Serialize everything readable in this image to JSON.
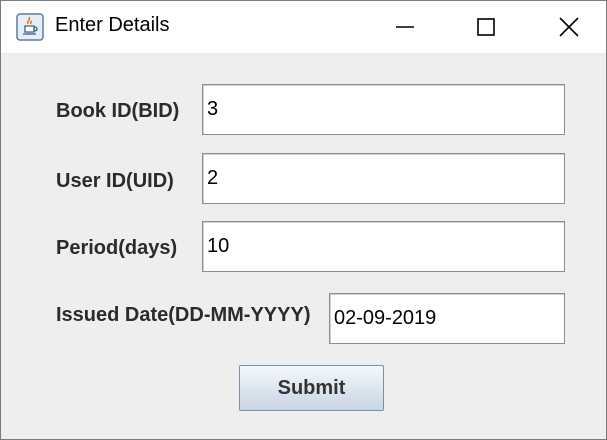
{
  "window": {
    "title": "Enter Details",
    "app_icon": "java-coffee-cup-icon",
    "controls": {
      "minimize_icon": "minimize-icon",
      "maximize_icon": "maximize-icon",
      "close_icon": "close-icon"
    }
  },
  "form": {
    "book_id": {
      "label": "Book ID(BID)",
      "value": "3"
    },
    "user_id": {
      "label": "User ID(UID)",
      "value": "2"
    },
    "period": {
      "label": "Period(days)",
      "value": "10"
    },
    "issued_date": {
      "label": "Issued Date(DD-MM-YYYY)",
      "value": "02-09-2019"
    },
    "submit_label": "Submit"
  },
  "colors": {
    "window_background": "#eeeeee",
    "titlebar_background": "#ffffff",
    "label_text": "#2b2b2b"
  }
}
